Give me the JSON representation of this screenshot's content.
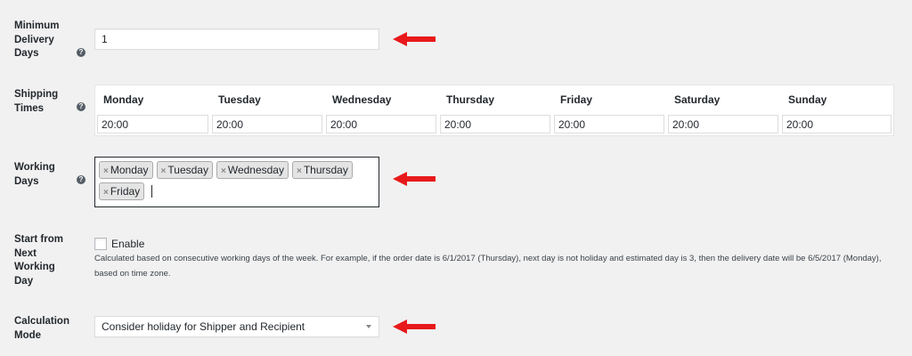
{
  "fields": {
    "min_delivery": {
      "label": "Minimum Delivery Days",
      "value": "1"
    },
    "shipping_times": {
      "label": "Shipping Times",
      "days": [
        {
          "day": "Monday",
          "time": "20:00"
        },
        {
          "day": "Tuesday",
          "time": "20:00"
        },
        {
          "day": "Wednesday",
          "time": "20:00"
        },
        {
          "day": "Thursday",
          "time": "20:00"
        },
        {
          "day": "Friday",
          "time": "20:00"
        },
        {
          "day": "Saturday",
          "time": "20:00"
        },
        {
          "day": "Sunday",
          "time": "20:00"
        }
      ]
    },
    "working_days": {
      "label": "Working Days",
      "remove_glyph": "×",
      "tags": [
        "Monday",
        "Tuesday",
        "Wednesday",
        "Thursday",
        "Friday"
      ]
    },
    "start_next": {
      "label": "Start from Next Working Day",
      "checkbox_label": "Enable",
      "checked": false,
      "description": "Calculated based on consecutive working days of the week. For example, if the order date is 6/1/2017 (Thursday), next day is not holiday and estimated day is 3, then the delivery date will be 6/5/2017 (Monday), based on time zone."
    },
    "calculation_mode": {
      "label": "Calculation Mode",
      "selected": "Consider holiday for Shipper and Recipient"
    }
  },
  "help_icon_glyph": "?",
  "colors": {
    "background": "#f1f1f1",
    "annotation_arrow": "#e8191b",
    "help_icon": "#555d66"
  },
  "icons": {
    "help": "question-mark-circle-icon",
    "annotation": "red-arrow-left-icon",
    "select": "chevron-down-icon"
  }
}
